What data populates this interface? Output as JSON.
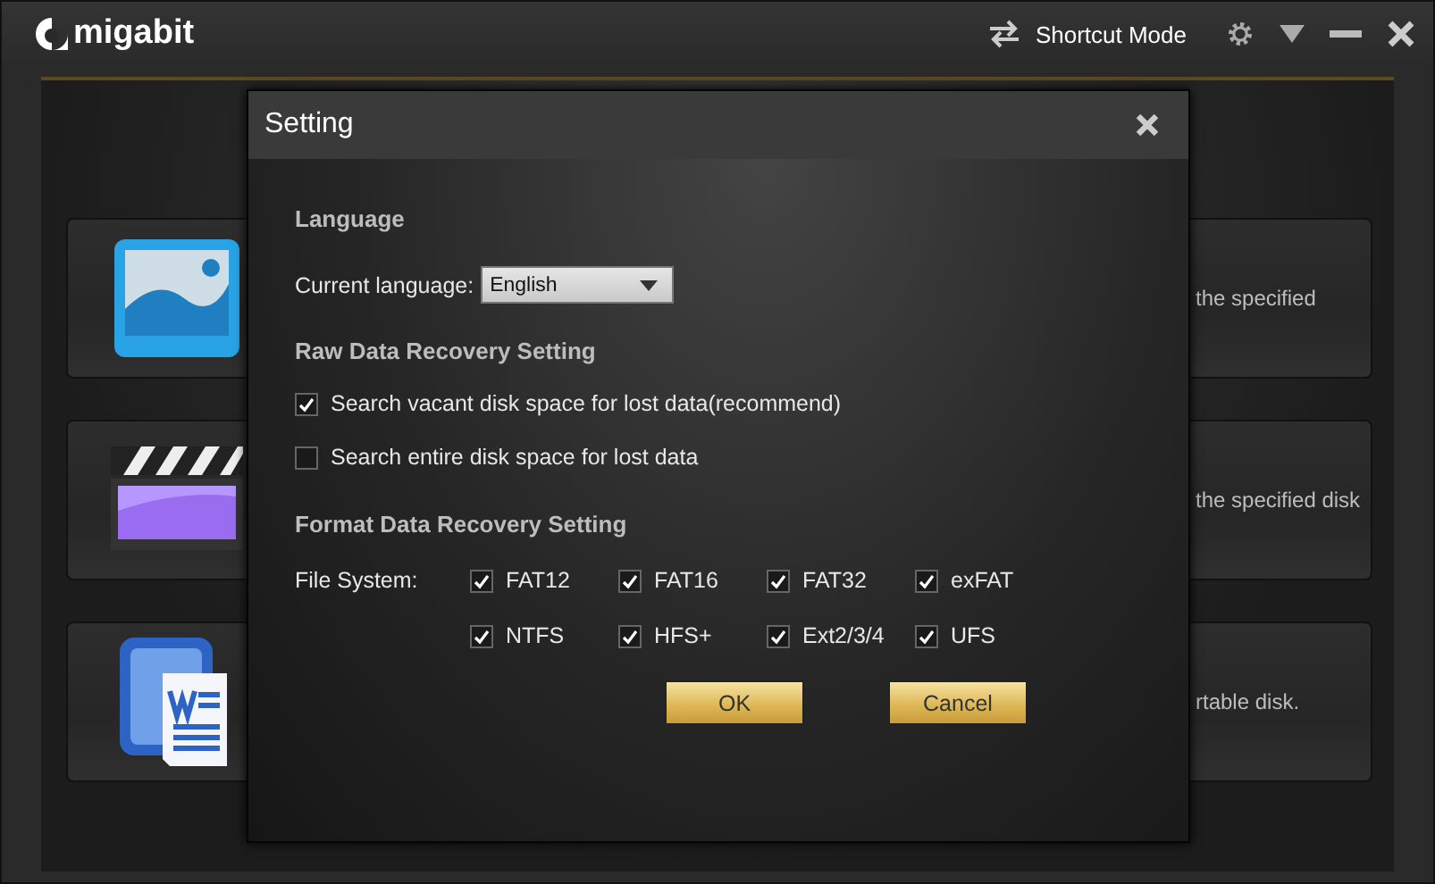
{
  "app": {
    "logo": "migabit",
    "shortcut_mode": "Shortcut Mode"
  },
  "cards": [
    {
      "text": "the specified"
    },
    {
      "text": "the specified disk"
    },
    {
      "text": "rtable disk."
    }
  ],
  "dialog": {
    "title": "Setting",
    "language": {
      "heading": "Language",
      "label": "Current language:",
      "value": "English"
    },
    "raw": {
      "heading": "Raw Data Recovery Setting",
      "options": [
        {
          "label": "Search vacant disk space for lost data(recommend)",
          "checked": true
        },
        {
          "label": "Search entire disk space for lost data",
          "checked": false
        }
      ]
    },
    "format": {
      "heading": "Format Data Recovery Setting",
      "label": "File System:",
      "file_systems": [
        {
          "label": "FAT12",
          "checked": true
        },
        {
          "label": "FAT16",
          "checked": true
        },
        {
          "label": "FAT32",
          "checked": true
        },
        {
          "label": "exFAT",
          "checked": true
        },
        {
          "label": "NTFS",
          "checked": true
        },
        {
          "label": "HFS+",
          "checked": true
        },
        {
          "label": "Ext2/3/4",
          "checked": true
        },
        {
          "label": "UFS",
          "checked": true
        }
      ]
    },
    "buttons": [
      "OK",
      "Cancel"
    ]
  }
}
